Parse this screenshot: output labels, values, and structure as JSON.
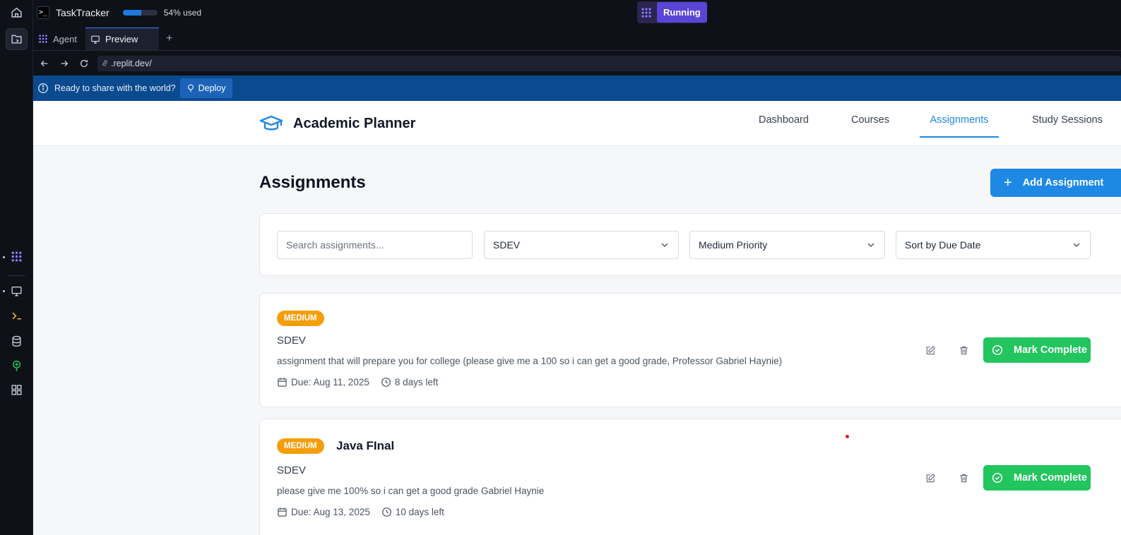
{
  "workspace": {
    "app_name": "TaskTracker",
    "usage_text": "54% used",
    "usage_fraction": 0.54,
    "run_label": "Running",
    "tabs": [
      {
        "label": "Agent"
      },
      {
        "label": "Preview"
      }
    ],
    "url_text": ".replit.dev/",
    "banner_text": "Ready to share with the world?",
    "deploy_label": "Deploy"
  },
  "app": {
    "brand": "Academic Planner",
    "nav": [
      "Dashboard",
      "Courses",
      "Assignments",
      "Study Sessions"
    ],
    "page_title": "Assignments",
    "add_label": "Add Assignment",
    "filters": {
      "search_placeholder": "Search assignments...",
      "course": "SDEV",
      "priority": "Medium Priority",
      "sort": "Sort by Due Date"
    },
    "assignments": [
      {
        "priority": "MEDIUM",
        "title": "",
        "course": "SDEV",
        "description": "assignment that will prepare you for college (please give me a 100 so i can get a good grade, Professor Gabriel Haynie)",
        "due": "Due: Aug 11, 2025",
        "days_left": "8 days left",
        "complete_label": "Mark Complete"
      },
      {
        "priority": "MEDIUM",
        "title": "Java FInal",
        "course": "SDEV",
        "description": "please give me 100% so i can get a good grade Gabriel Haynie",
        "due": "Due: Aug 13, 2025",
        "days_left": "10 days left",
        "complete_label": "Mark Complete"
      }
    ]
  },
  "colors": {
    "accent": "#1e88e5",
    "priority_medium": "#f59e0b",
    "complete": "#22c55e",
    "banner": "#0a4a8f",
    "run": "#5b45d6"
  }
}
